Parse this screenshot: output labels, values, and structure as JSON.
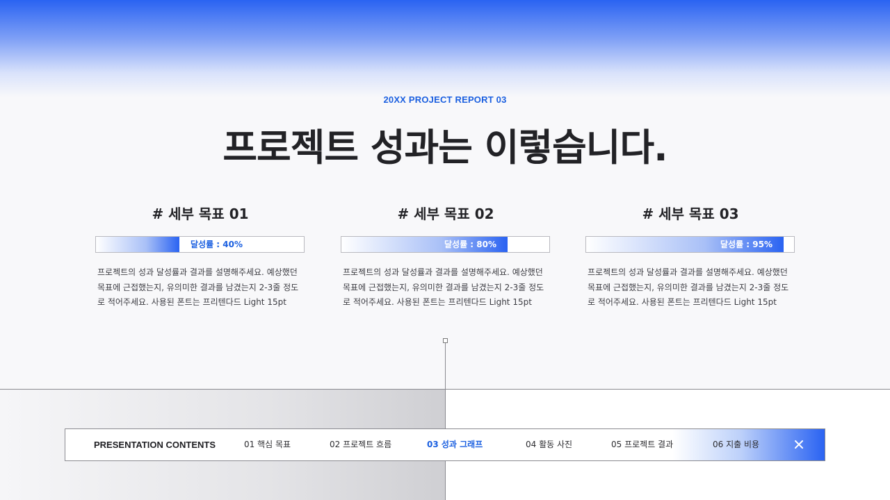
{
  "header": {
    "subtitle": "20XX PROJECT REPORT 03",
    "title": "프로젝트 성과는 이렇습니다."
  },
  "goals": [
    {
      "title": "# 세부 목표 01",
      "rate_label": "달성률 : 40%",
      "progress": 0.4,
      "description": "프로젝트의 성과 달성률과 결과를 설명해주세요. 예상했던 목표에 근접했는지, 유의미한 결과를 남겼는지 2-3줄 정도로 적어주세요. 사용된 폰트는 프리텐다드 Light 15pt"
    },
    {
      "title": "# 세부 목표 02",
      "rate_label": "달성률 : 80%",
      "progress": 0.8,
      "description": "프로젝트의 성과 달성률과 결과를 설명해주세요. 예상했던 목표에 근접했는지, 유의미한 결과를 남겼는지 2-3줄 정도로 적어주세요. 사용된 폰트는 프리텐다드 Light 15pt"
    },
    {
      "title": "# 세부 목표 03",
      "rate_label": "달성률 : 95%",
      "progress": 0.95,
      "description": "프로젝트의 성과 달성률과 결과를 설명해주세요. 예상했던 목표에 근접했는지, 유의미한 결과를 남겼는지 2-3줄 정도로 적어주세요. 사용된 폰트는 프리텐다드 Light 15pt"
    }
  ],
  "nav": {
    "heading": "PRESENTATION CONTENTS",
    "items": [
      {
        "label": "01 핵심 목표",
        "active": false
      },
      {
        "label": "02 프로젝트 흐름",
        "active": false
      },
      {
        "label": "03 성과 그래프",
        "active": true
      },
      {
        "label": "04 활동 사진",
        "active": false
      },
      {
        "label": "05 프로젝트 결과",
        "active": false
      },
      {
        "label": "06 지출 비용",
        "active": false
      }
    ],
    "close_icon": "close-icon"
  },
  "colors": {
    "accent": "#2a63f2",
    "accent_text": "#1a5fe0",
    "text_dark": "#222226"
  }
}
